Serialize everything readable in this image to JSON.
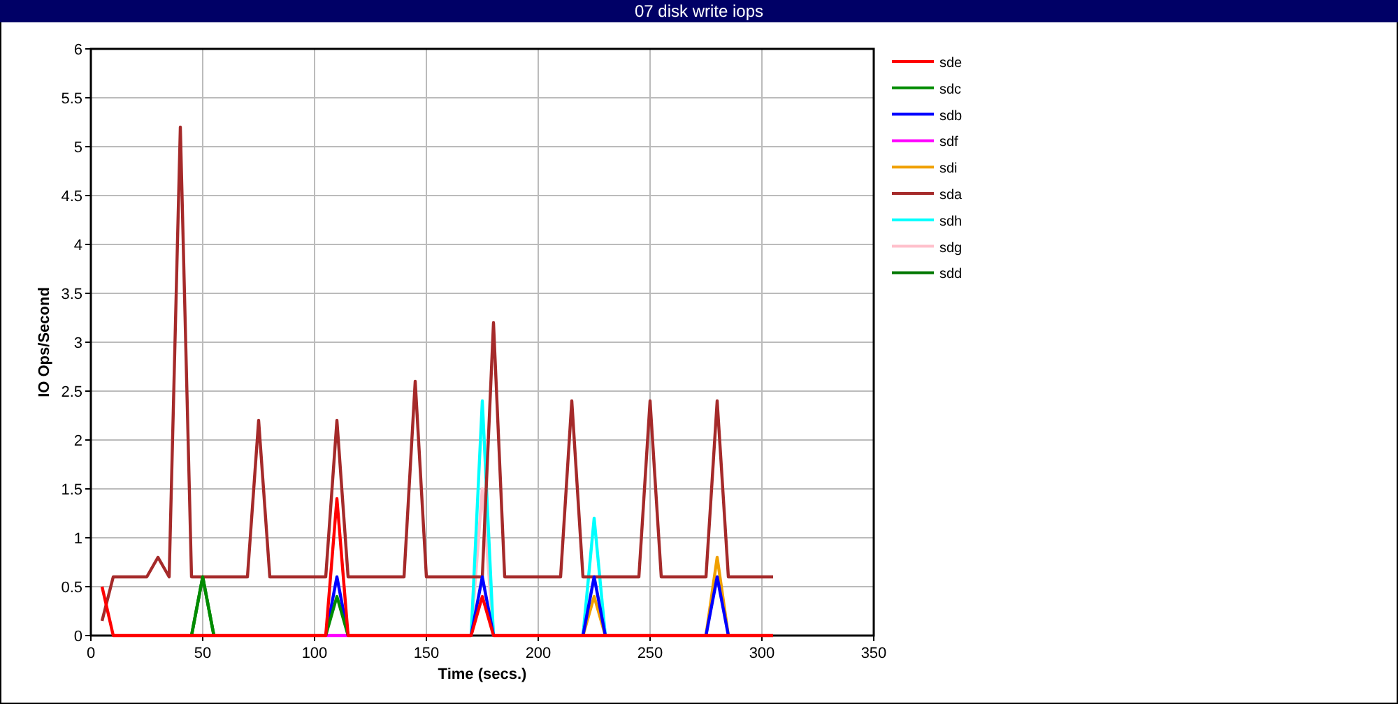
{
  "title": "07 disk write iops",
  "chart_data": {
    "type": "line",
    "xlabel": "Time (secs.)",
    "ylabel": "IO Ops/Second",
    "grid": true,
    "legend": true,
    "x": [
      5,
      10,
      15,
      20,
      25,
      30,
      35,
      40,
      45,
      50,
      55,
      60,
      65,
      70,
      75,
      80,
      85,
      90,
      95,
      100,
      105,
      110,
      115,
      120,
      125,
      130,
      135,
      140,
      145,
      150,
      155,
      160,
      165,
      170,
      175,
      180,
      185,
      190,
      195,
      200,
      205,
      210,
      215,
      220,
      225,
      230,
      235,
      240,
      245,
      250,
      255,
      260,
      265,
      270,
      275,
      280,
      285,
      290,
      295,
      300,
      305
    ],
    "xlim": [
      0,
      350
    ],
    "ylim": [
      0,
      6
    ],
    "xticks": [
      0,
      50,
      100,
      150,
      200,
      250,
      300,
      350
    ],
    "yticks": [
      0,
      0.5,
      1,
      1.5,
      2,
      2.5,
      3,
      3.5,
      4,
      4.5,
      5,
      5.5,
      6
    ],
    "series": [
      {
        "name": "sde",
        "color": "#ff0000",
        "values": [
          0.5,
          0,
          0,
          0,
          0,
          0,
          0,
          0,
          0,
          0,
          0,
          0,
          0,
          0,
          0,
          0,
          0,
          0,
          0,
          0,
          0,
          1.4,
          0,
          0,
          0,
          0,
          0,
          0,
          0,
          0,
          0,
          0,
          0,
          0,
          0.4,
          0,
          0,
          0,
          0,
          0,
          0,
          0,
          0,
          0,
          0,
          0,
          0,
          0,
          0,
          0,
          0,
          0,
          0,
          0,
          0,
          0,
          0,
          0,
          0,
          0,
          0
        ]
      },
      {
        "name": "sdc",
        "color": "#008c00",
        "values": [
          null,
          null,
          null,
          null,
          null,
          null,
          null,
          null,
          0,
          0.6,
          0,
          null,
          null,
          null,
          null,
          null,
          null,
          null,
          null,
          null,
          0,
          0.4,
          0,
          null,
          null,
          null,
          null,
          null,
          null,
          null,
          null,
          null,
          null,
          null,
          null,
          null,
          null,
          null,
          null,
          null,
          null,
          null,
          null,
          null,
          null,
          null,
          null,
          null,
          null,
          null,
          null,
          null,
          null,
          null,
          null,
          null,
          null,
          null,
          null,
          null,
          null
        ]
      },
      {
        "name": "sdb",
        "color": "#0000ff",
        "values": [
          null,
          null,
          null,
          null,
          null,
          null,
          null,
          null,
          null,
          null,
          null,
          null,
          null,
          null,
          null,
          null,
          null,
          null,
          null,
          null,
          0,
          0.6,
          0,
          null,
          null,
          null,
          null,
          null,
          null,
          null,
          null,
          null,
          null,
          0,
          0.6,
          0,
          null,
          null,
          null,
          null,
          null,
          null,
          null,
          0,
          0.6,
          0,
          null,
          null,
          null,
          null,
          null,
          null,
          null,
          null,
          0,
          0.6,
          0,
          null,
          null,
          null,
          null
        ]
      },
      {
        "name": "sdf",
        "color": "#ff00ff",
        "values": [
          null,
          null,
          null,
          null,
          null,
          null,
          null,
          null,
          null,
          null,
          null,
          null,
          null,
          null,
          null,
          null,
          null,
          null,
          null,
          null,
          0,
          0,
          0,
          null,
          null,
          null,
          null,
          null,
          null,
          null,
          null,
          null,
          null,
          null,
          null,
          null,
          null,
          null,
          null,
          null,
          null,
          null,
          null,
          null,
          null,
          null,
          null,
          null,
          null,
          null,
          null,
          null,
          null,
          null,
          null,
          null,
          null,
          null,
          null,
          null,
          null
        ]
      },
      {
        "name": "sdi",
        "color": "#f0a000",
        "values": [
          null,
          null,
          null,
          null,
          null,
          null,
          null,
          null,
          null,
          null,
          null,
          null,
          null,
          null,
          null,
          null,
          null,
          null,
          null,
          null,
          null,
          null,
          null,
          null,
          null,
          null,
          null,
          null,
          null,
          null,
          null,
          null,
          null,
          null,
          null,
          null,
          null,
          null,
          null,
          null,
          null,
          null,
          null,
          0,
          0.4,
          0,
          null,
          null,
          null,
          null,
          null,
          null,
          null,
          null,
          0,
          0.8,
          0,
          null,
          null,
          null,
          null
        ]
      },
      {
        "name": "sda",
        "color": "#a52a2a",
        "values": [
          0.15,
          0.6,
          0.6,
          0.6,
          0.6,
          0.8,
          0.6,
          5.2,
          0.6,
          0.6,
          0.6,
          0.6,
          0.6,
          0.6,
          2.2,
          0.6,
          0.6,
          0.6,
          0.6,
          0.6,
          0.6,
          2.2,
          0.6,
          0.6,
          0.6,
          0.6,
          0.6,
          0.6,
          2.6,
          0.6,
          0.6,
          0.6,
          0.6,
          0.6,
          0.6,
          3.2,
          0.6,
          0.6,
          0.6,
          0.6,
          0.6,
          0.6,
          2.4,
          0.6,
          0.6,
          0.6,
          0.6,
          0.6,
          0.6,
          2.4,
          0.6,
          0.6,
          0.6,
          0.6,
          0.6,
          2.4,
          0.6,
          0.6,
          0.6,
          0.6,
          0.6
        ]
      },
      {
        "name": "sdh",
        "color": "#00ffff",
        "values": [
          null,
          null,
          null,
          null,
          null,
          null,
          null,
          null,
          null,
          null,
          null,
          null,
          null,
          null,
          null,
          null,
          null,
          null,
          null,
          null,
          null,
          null,
          null,
          null,
          null,
          null,
          null,
          null,
          null,
          null,
          null,
          null,
          null,
          0,
          2.4,
          0,
          null,
          null,
          null,
          null,
          null,
          null,
          null,
          0,
          1.2,
          0,
          null,
          null,
          null,
          null,
          null,
          null,
          null,
          null,
          null,
          null,
          null,
          null,
          null,
          null,
          null
        ]
      },
      {
        "name": "sdg",
        "color": "#ffc0cb",
        "values": [
          null,
          null,
          null,
          null,
          null,
          null,
          null,
          null,
          null,
          null,
          null,
          null,
          null,
          null,
          null,
          null,
          null,
          null,
          null,
          null,
          null,
          null,
          null,
          null,
          null,
          null,
          null,
          null,
          null,
          null,
          null,
          null,
          null,
          0,
          1.5,
          0,
          null,
          null,
          null,
          null,
          null,
          null,
          null,
          null,
          null,
          null,
          null,
          null,
          null,
          null,
          null,
          null,
          null,
          null,
          null,
          null,
          null,
          null,
          null,
          null,
          null
        ]
      },
      {
        "name": "sdd",
        "color": "#007800",
        "values": [
          null,
          null,
          null,
          null,
          null,
          null,
          null,
          null,
          0,
          0.6,
          0,
          null,
          null,
          null,
          null,
          null,
          null,
          null,
          null,
          null,
          null,
          null,
          null,
          null,
          null,
          null,
          null,
          null,
          null,
          null,
          null,
          null,
          null,
          null,
          null,
          null,
          null,
          null,
          null,
          null,
          null,
          null,
          null,
          null,
          null,
          null,
          null,
          null,
          null,
          null,
          null,
          null,
          null,
          null,
          null,
          null,
          null,
          null,
          null,
          null,
          null
        ]
      }
    ]
  }
}
